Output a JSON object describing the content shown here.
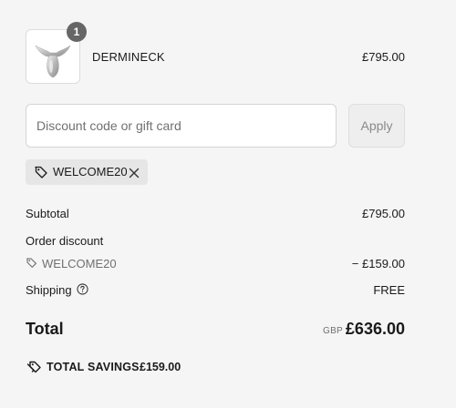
{
  "product": {
    "quantity": "1",
    "name": "DERMINECK",
    "price": "£795.00",
    "image_icon": "neck-massager-device-image"
  },
  "discount": {
    "placeholder": "Discount code or gift card",
    "value": "",
    "apply_label": "Apply",
    "applied_code": "WELCOME20",
    "tag_icon": "tag-icon",
    "remove_icon": "close-icon"
  },
  "summary": {
    "subtotal_label": "Subtotal",
    "subtotal_value": "£795.00",
    "order_discount_label": "Order discount",
    "discount_code": "WELCOME20",
    "discount_value": "− £159.00",
    "shipping_label": "Shipping",
    "shipping_value": "FREE",
    "shipping_help_icon": "help-circle-icon"
  },
  "total": {
    "label": "Total",
    "currency": "GBP",
    "value": "£636.00"
  },
  "savings": {
    "icon": "double-tag-icon",
    "label": "TOTAL SAVINGS",
    "value": "£159.00"
  },
  "colors": {
    "background": "#f5f5f5",
    "text": "#1a1a1a",
    "muted_text": "#707070",
    "chip_background": "#e6e6e6",
    "badge": "#666666"
  }
}
